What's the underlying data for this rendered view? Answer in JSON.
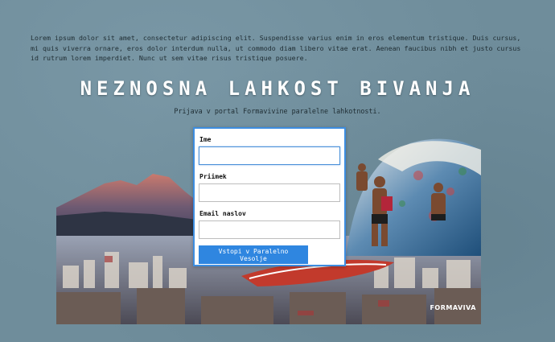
{
  "intro_text": "Lorem ipsum dolor sit amet, consectetur adipiscing elit. Suspendisse varius enim in eros elementum tristique. Duis cursus, mi quis viverra ornare, eros dolor interdum nulla, ut commodo diam libero vitae erat. Aenean faucibus nibh et justo cursus id rutrum lorem imperdiet. Nunc ut sem vitae risus tristique posuere.",
  "title": "NEZNOSNA LAHKOST BIVANJA",
  "subtitle": "Prijava v portal Formavivine paralelne lahkotnosti.",
  "form": {
    "first_name_label": "Ime",
    "first_name_value": "",
    "last_name_label": "Priimek",
    "last_name_value": "",
    "email_label": "Email naslov",
    "email_value": "",
    "submit_label": "Vstopi v Paralelno Vesolje"
  },
  "collage": {
    "brand": "FORMAVIVA"
  }
}
